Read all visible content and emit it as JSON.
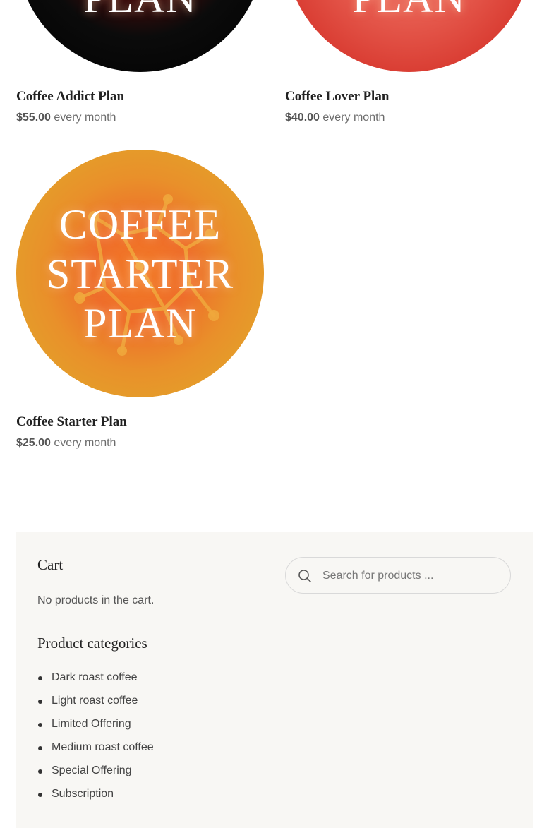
{
  "products": [
    {
      "name": "Coffee Addict Plan",
      "price": "$55.00",
      "period": "every month",
      "image_text": "COFFEE\nADDICT\nPLAN"
    },
    {
      "name": "Coffee Lover Plan",
      "price": "$40.00",
      "period": "every month",
      "image_text": "COFFEE\nLOVER\nPLAN"
    },
    {
      "name": "Coffee Starter Plan",
      "price": "$25.00",
      "period": "every month",
      "image_text": "COFFEE\nSTARTER\nPLAN"
    }
  ],
  "sidebar": {
    "cart_title": "Cart",
    "cart_empty": "No products in the cart.",
    "categories_title": "Product categories",
    "categories": [
      "Dark roast coffee",
      "Light roast coffee",
      "Limited Offering",
      "Medium roast coffee",
      "Special Offering",
      "Subscription"
    ],
    "search_placeholder": "Search for products ..."
  },
  "colors": {
    "addict_image": "#000000",
    "lover_image": "#d83a30",
    "starter_image": "#e2a12a",
    "panel_background": "#f8f7f4"
  },
  "icons": {
    "search": "search-icon"
  }
}
